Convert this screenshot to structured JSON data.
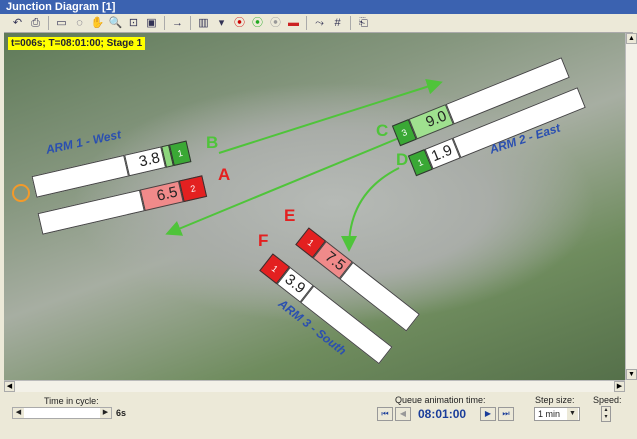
{
  "window": {
    "title": "Junction Diagram [1]"
  },
  "toolbar": {
    "icons": [
      "undo-icon",
      "print-icon",
      "rect-select-icon",
      "lasso-select-icon",
      "pan-hand-icon",
      "zoom-icon",
      "zoom-fit-icon",
      "image-icon",
      "arrow-label-icon",
      "lanes-icon",
      "dropdown-icon",
      "traffic-light-icon",
      "traffic-light-edit-icon",
      "signal-disabled-icon",
      "queue-bar-icon",
      "flow-arrows-icon",
      "grid-icon",
      "export-icon"
    ]
  },
  "status": "t=006s;  T=08:01:00; Stage 1",
  "arms": {
    "west": {
      "label": "ARM 1 - West",
      "lanes": [
        {
          "id": "B",
          "queue": "3.8",
          "signal": "1",
          "color": "#3aa835"
        },
        {
          "id": "A",
          "queue": "6.5",
          "signal": "2",
          "color": "#e32020"
        }
      ]
    },
    "east": {
      "label": "ARM 2 - East",
      "lanes": [
        {
          "id": "C",
          "queue": "9.0",
          "signal": "3",
          "color": "#3aa835"
        },
        {
          "id": "D",
          "queue": "1.9",
          "signal": "1",
          "color": "#3aa835"
        }
      ]
    },
    "south": {
      "label": "ARM 3 - South",
      "lanes": [
        {
          "id": "E",
          "queue": "7.5",
          "signal": "1",
          "color": "#e32020"
        },
        {
          "id": "F",
          "queue": "3.9",
          "signal": "1",
          "color": "#e32020"
        }
      ]
    }
  },
  "bottom": {
    "time_in_cycle_label": "Time in cycle:",
    "time_in_cycle_value": "6s",
    "cycle_fraction": 0.0,
    "queue_anim_label": "Queue animation time:",
    "queue_anim_time": "08:01:00",
    "step_size_label": "Step size:",
    "step_size": "1 min",
    "speed_label": "Speed:"
  }
}
